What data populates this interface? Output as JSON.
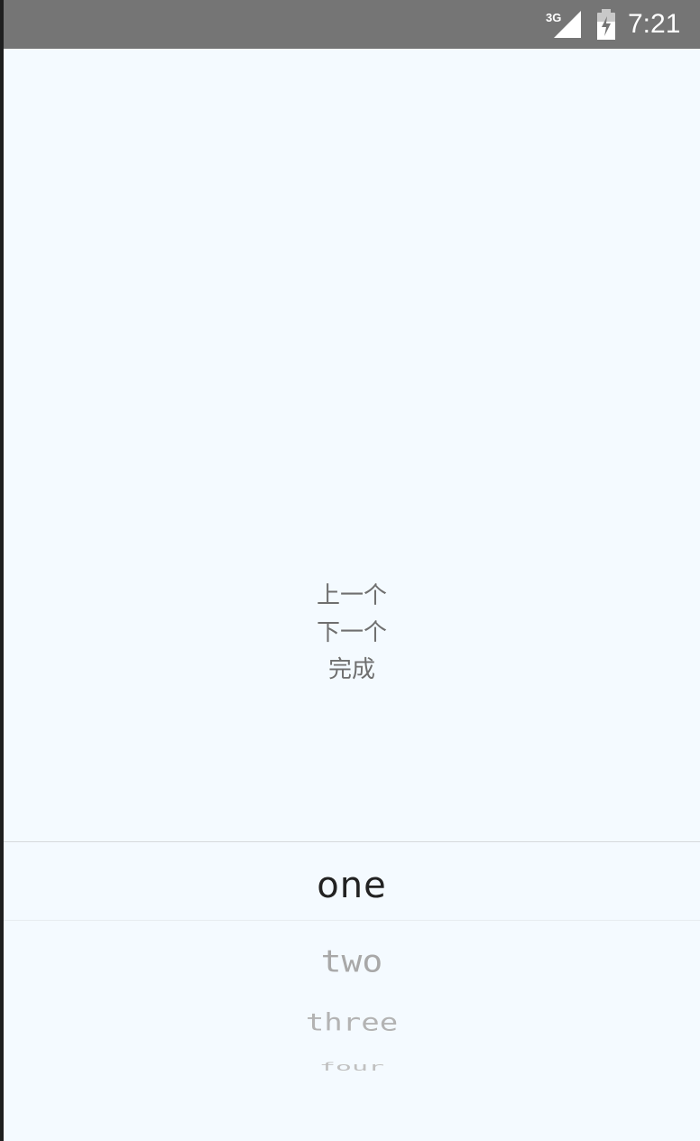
{
  "status_bar": {
    "network": "3G",
    "time": "7:21",
    "background_color": "#757575",
    "icons": [
      "signal-3g-icon",
      "battery-charging-icon"
    ]
  },
  "toolbar": {
    "prev_label": "上一个",
    "next_label": "下一个",
    "done_label": "完成"
  },
  "picker": {
    "selected_index": 0,
    "items": [
      "one",
      "two",
      "three",
      "four"
    ]
  },
  "colors": {
    "screen_background": "#f4faff",
    "selected_text": "#222222",
    "unselected_text": "#a8a8a8",
    "toolbar_text": "#6f6f6f"
  }
}
